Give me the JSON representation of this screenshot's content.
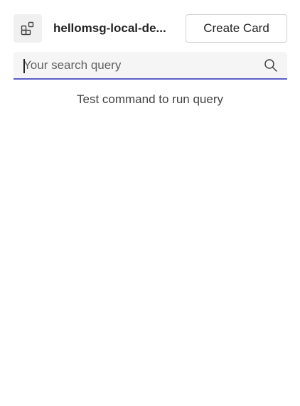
{
  "header": {
    "app_icon": "app-grid-icon",
    "app_title": "hellomsg-local-de...",
    "create_label": "Create Card"
  },
  "search": {
    "placeholder": "Your search query",
    "value": "",
    "icon": "search-icon",
    "accent_color": "#5b5fc7"
  },
  "main": {
    "hint_text": "Test command to run query"
  }
}
